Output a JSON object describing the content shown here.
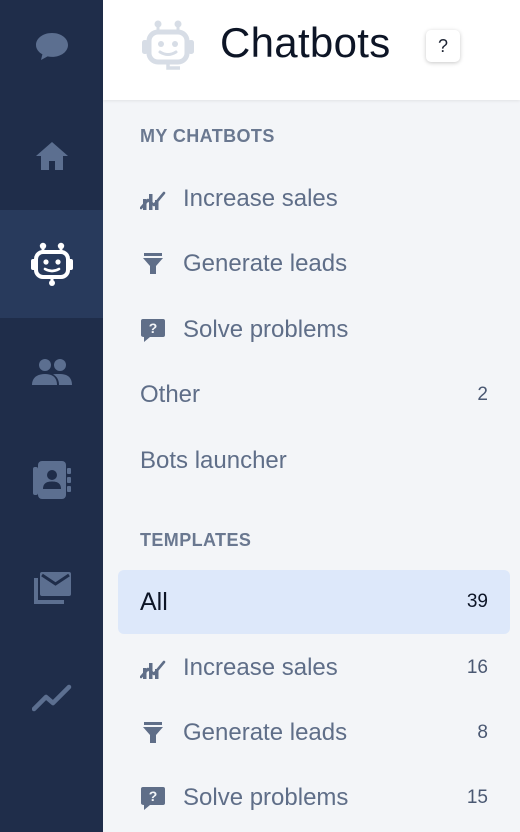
{
  "header": {
    "title": "Chatbots",
    "help_label": "?"
  },
  "rail": {
    "items": [
      {
        "icon": "chat-bubble-icon"
      },
      {
        "icon": "home-icon"
      },
      {
        "icon": "chatbot-icon",
        "active": true
      },
      {
        "icon": "people-icon"
      },
      {
        "icon": "contacts-book-icon"
      },
      {
        "icon": "mail-stack-icon"
      },
      {
        "icon": "trend-chart-icon"
      }
    ]
  },
  "my_chatbots": {
    "title": "MY CHATBOTS",
    "items": [
      {
        "label": "Increase sales",
        "icon": "sales-chart-icon"
      },
      {
        "label": "Generate leads",
        "icon": "funnel-icon"
      },
      {
        "label": "Solve problems",
        "icon": "question-bubble-icon"
      },
      {
        "label": "Other",
        "count": "2"
      },
      {
        "label": "Bots launcher"
      }
    ]
  },
  "templates": {
    "title": "TEMPLATES",
    "items": [
      {
        "label": "All",
        "count": "39",
        "selected": true
      },
      {
        "label": "Increase sales",
        "count": "16",
        "icon": "sales-chart-icon"
      },
      {
        "label": "Generate leads",
        "count": "8",
        "icon": "funnel-icon"
      },
      {
        "label": "Solve problems",
        "count": "15",
        "icon": "question-bubble-icon"
      }
    ]
  },
  "colors": {
    "rail_bg": "#1f2d4a",
    "rail_active": "#283a5c",
    "rail_icon": "#5c6f90",
    "selected_bg": "#dde8fa",
    "text_muted": "#5f6e88"
  }
}
